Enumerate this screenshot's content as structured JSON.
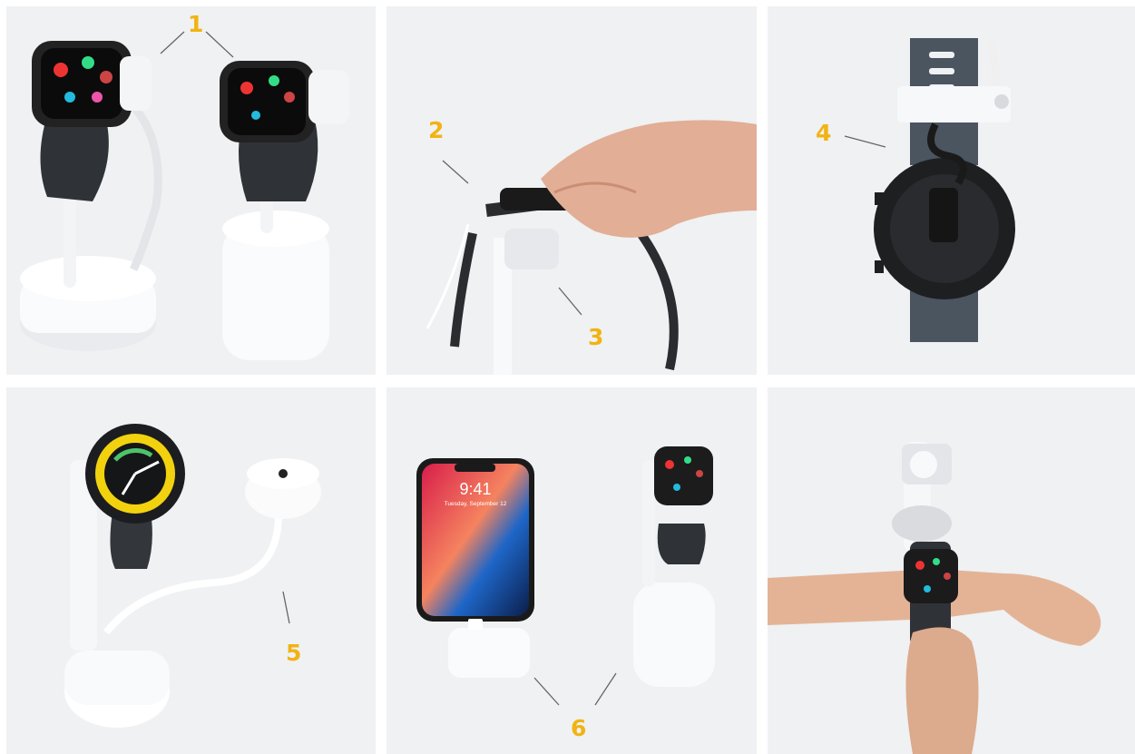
{
  "colors": {
    "callout": "#f2b313",
    "panel_background": "#eff1f3",
    "stand_white": "#f7f8f9",
    "strap_dark": "#2f3236"
  },
  "callouts": [
    "1",
    "2",
    "3",
    "4",
    "5",
    "6"
  ],
  "phone_screen": {
    "time": "9:41",
    "date": "Tuesday, September 12"
  },
  "panels": [
    {
      "subject": "two-watches-on-stands"
    },
    {
      "subject": "hand-lifting-watch-from-sensor"
    },
    {
      "subject": "watch-back-with-clamp-sensor"
    },
    {
      "subject": "round-smartwatch-on-stand-with-cable"
    },
    {
      "subject": "phone-and-watch-stands"
    },
    {
      "subject": "customer-trying-on-watch"
    }
  ]
}
